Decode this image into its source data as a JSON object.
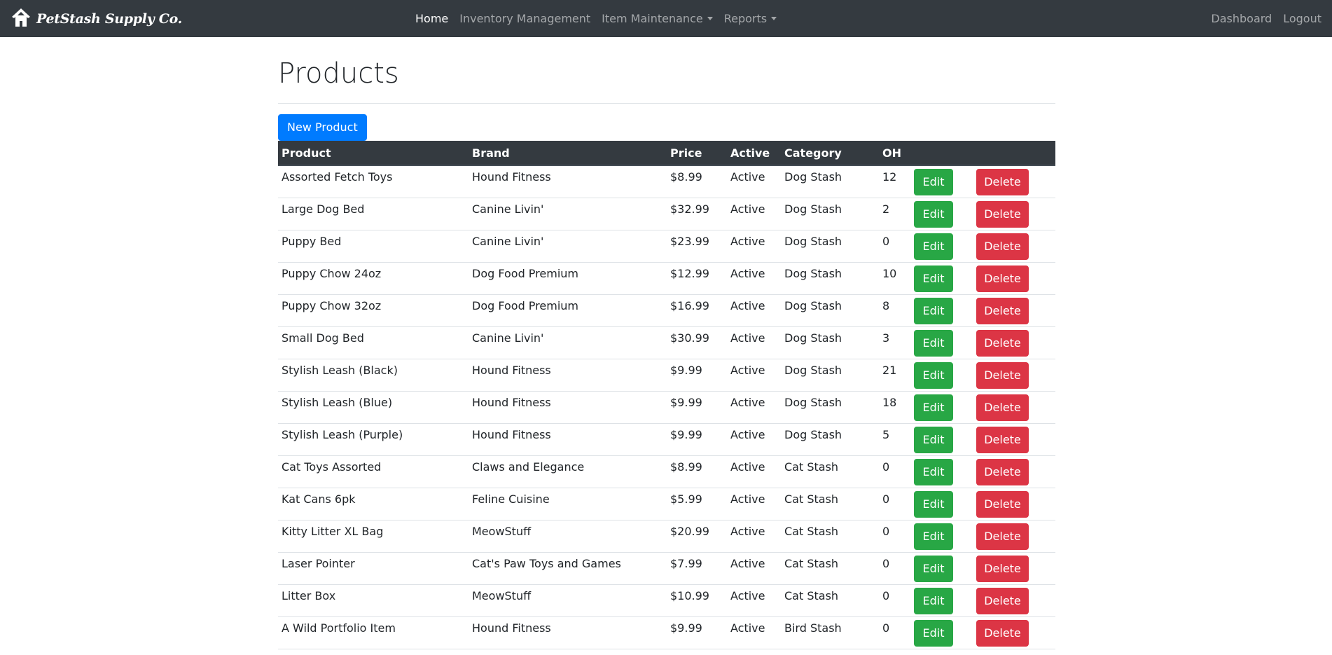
{
  "navbar": {
    "brand": "PetStash Supply Co.",
    "brand_icon": "house-icon",
    "links": [
      {
        "label": "Home",
        "active": true
      },
      {
        "label": "Inventory Management"
      },
      {
        "label": "Item Maintenance",
        "dropdown": true
      },
      {
        "label": "Reports",
        "dropdown": true
      }
    ],
    "right_links": [
      "Dashboard",
      "Logout"
    ]
  },
  "page": {
    "title": "Products",
    "new_button": "New Product"
  },
  "table": {
    "headers": [
      "Product",
      "Brand",
      "Price",
      "Active",
      "Category",
      "OH",
      "",
      ""
    ],
    "edit_label": "Edit",
    "delete_label": "Delete",
    "rows": [
      {
        "product": "Assorted Fetch Toys",
        "brand": "Hound Fitness",
        "price": "$8.99",
        "active": "Active",
        "category": "Dog Stash",
        "oh": "12"
      },
      {
        "product": "Large Dog Bed",
        "brand": "Canine Livin'",
        "price": "$32.99",
        "active": "Active",
        "category": "Dog Stash",
        "oh": "2"
      },
      {
        "product": "Puppy Bed",
        "brand": "Canine Livin'",
        "price": "$23.99",
        "active": "Active",
        "category": "Dog Stash",
        "oh": "0"
      },
      {
        "product": "Puppy Chow 24oz",
        "brand": "Dog Food Premium",
        "price": "$12.99",
        "active": "Active",
        "category": "Dog Stash",
        "oh": "10"
      },
      {
        "product": "Puppy Chow 32oz",
        "brand": "Dog Food Premium",
        "price": "$16.99",
        "active": "Active",
        "category": "Dog Stash",
        "oh": "8"
      },
      {
        "product": "Small Dog Bed",
        "brand": "Canine Livin'",
        "price": "$30.99",
        "active": "Active",
        "category": "Dog Stash",
        "oh": "3"
      },
      {
        "product": "Stylish Leash (Black)",
        "brand": "Hound Fitness",
        "price": "$9.99",
        "active": "Active",
        "category": "Dog Stash",
        "oh": "21"
      },
      {
        "product": "Stylish Leash (Blue)",
        "brand": "Hound Fitness",
        "price": "$9.99",
        "active": "Active",
        "category": "Dog Stash",
        "oh": "18"
      },
      {
        "product": "Stylish Leash (Purple)",
        "brand": "Hound Fitness",
        "price": "$9.99",
        "active": "Active",
        "category": "Dog Stash",
        "oh": "5"
      },
      {
        "product": "Cat Toys Assorted",
        "brand": "Claws and Elegance",
        "price": "$8.99",
        "active": "Active",
        "category": "Cat Stash",
        "oh": "0"
      },
      {
        "product": "Kat Cans 6pk",
        "brand": "Feline Cuisine",
        "price": "$5.99",
        "active": "Active",
        "category": "Cat Stash",
        "oh": "0"
      },
      {
        "product": "Kitty Litter XL Bag",
        "brand": "MeowStuff",
        "price": "$20.99",
        "active": "Active",
        "category": "Cat Stash",
        "oh": "0"
      },
      {
        "product": "Laser Pointer",
        "brand": "Cat's Paw Toys and Games",
        "price": "$7.99",
        "active": "Active",
        "category": "Cat Stash",
        "oh": "0"
      },
      {
        "product": "Litter Box",
        "brand": "MeowStuff",
        "price": "$10.99",
        "active": "Active",
        "category": "Cat Stash",
        "oh": "0"
      },
      {
        "product": "A Wild Portfolio Item",
        "brand": "Hound Fitness",
        "price": "$9.99",
        "active": "Active",
        "category": "Bird Stash",
        "oh": "0"
      }
    ]
  },
  "colors": {
    "navbar_bg": "#343a40",
    "primary": "#007bff",
    "success": "#28a745",
    "danger": "#dc3545"
  }
}
